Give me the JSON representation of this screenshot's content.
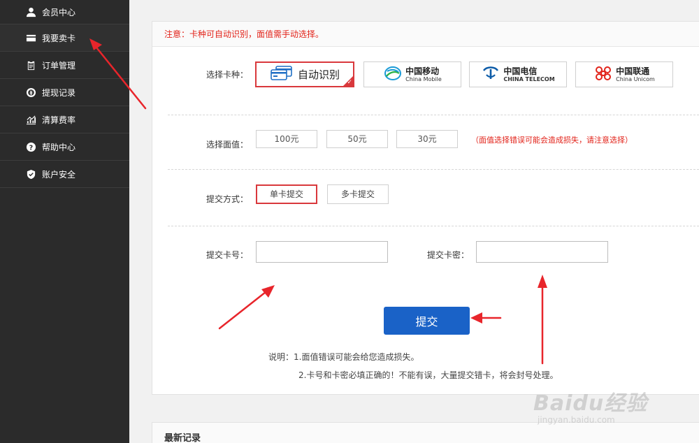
{
  "sidebar": {
    "items": [
      {
        "label": "会员中心",
        "icon": "user-icon"
      },
      {
        "label": "我要卖卡",
        "icon": "card-icon"
      },
      {
        "label": "订单管理",
        "icon": "clipboard-icon"
      },
      {
        "label": "提现记录",
        "icon": "coin-icon"
      },
      {
        "label": "清算费率",
        "icon": "chart-icon"
      },
      {
        "label": "帮助中心",
        "icon": "help-icon"
      },
      {
        "label": "账户安全",
        "icon": "shield-icon"
      }
    ]
  },
  "notice": "注意：卡种可自动识别，面值需手动选择。",
  "card_type": {
    "label": "选择卡种：",
    "options": [
      {
        "label": "自动识别",
        "selected": true
      },
      {
        "cn": "中国移动",
        "en": "China Mobile"
      },
      {
        "cn": "中国电信",
        "en": "CHINA TELECOM"
      },
      {
        "cn": "中国联通",
        "en": "China Unicom"
      }
    ]
  },
  "face_value": {
    "label": "选择面值：",
    "options": [
      "100元",
      "50元",
      "30元"
    ],
    "warning": "（面值选择错误可能会造成损失，请注意选择）"
  },
  "submit_mode": {
    "label": "提交方式：",
    "options": [
      {
        "label": "单卡提交",
        "selected": true
      },
      {
        "label": "多卡提交",
        "selected": false
      }
    ]
  },
  "card_number": {
    "label": "提交卡号：",
    "value": ""
  },
  "card_password": {
    "label": "提交卡密：",
    "value": ""
  },
  "submit_label": "提交",
  "notes": {
    "line1": "说明：1.面值错误可能会给您造成损失。",
    "line2": "2.卡号和卡密必填正确的！不能有误，大量提交错卡，将会封号处理。"
  },
  "recent": {
    "title": "最新记录"
  },
  "watermark": {
    "brand": "Baidu经验",
    "url": "jingyan.baidu.com"
  },
  "colors": {
    "accent": "#d9383c",
    "primary": "#1a62c7",
    "sidebar": "#2b2b2b",
    "warning": "#e2231a"
  }
}
